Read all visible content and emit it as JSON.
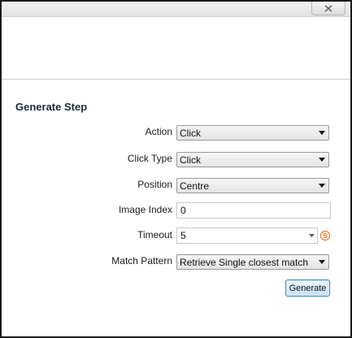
{
  "window": {
    "close_icon": "close-x-icon"
  },
  "section": {
    "title": "Generate Step"
  },
  "fields": {
    "action": {
      "label": "Action",
      "value": "Click"
    },
    "click_type": {
      "label": "Click Type",
      "value": "Click"
    },
    "position": {
      "label": "Position",
      "value": "Centre"
    },
    "image_index": {
      "label": "Image Index",
      "value": "0"
    },
    "timeout": {
      "label": "Timeout",
      "value": "5",
      "unit_glyph": "S"
    },
    "match_pattern": {
      "label": "Match Pattern",
      "value": "Retrieve Single closest match"
    }
  },
  "buttons": {
    "generate": "Generate"
  },
  "colors": {
    "section_title": "#1b2a3a",
    "unit_badge": "#e06a1c",
    "button_border": "#3c7fb1"
  }
}
